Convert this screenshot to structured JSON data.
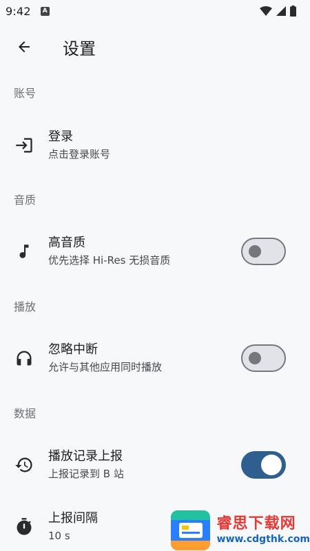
{
  "status_bar": {
    "time": "9:42",
    "notification_letter": "A"
  },
  "app_bar": {
    "title": "设置"
  },
  "sections": [
    {
      "header": "账号"
    },
    {
      "header": "音质"
    },
    {
      "header": "播放"
    },
    {
      "header": "数据"
    }
  ],
  "rows": {
    "login": {
      "title": "登录",
      "subtitle": "点击登录账号",
      "icon": "login-icon"
    },
    "hq_audio": {
      "title": "高音质",
      "subtitle": "优先选择 Hi-Res 无损音质",
      "icon": "music-note-icon",
      "enabled": false
    },
    "ignore_interrupt": {
      "title": "忽略中断",
      "subtitle": "允许与其他应用同时播放",
      "icon": "headphones-icon",
      "enabled": false
    },
    "report_history": {
      "title": "播放记录上报",
      "subtitle": "上报记录到 B 站",
      "icon": "history-icon",
      "enabled": true
    },
    "report_interval": {
      "title": "上报间隔",
      "subtitle": "10 s",
      "icon": "timer-icon"
    }
  },
  "watermark": {
    "name": "睿思下载网",
    "url": "www.cdgthk.com"
  },
  "colors": {
    "accent": "#2f5f8f",
    "background": "#f7f8fa",
    "section_header": "#6d6f75"
  }
}
